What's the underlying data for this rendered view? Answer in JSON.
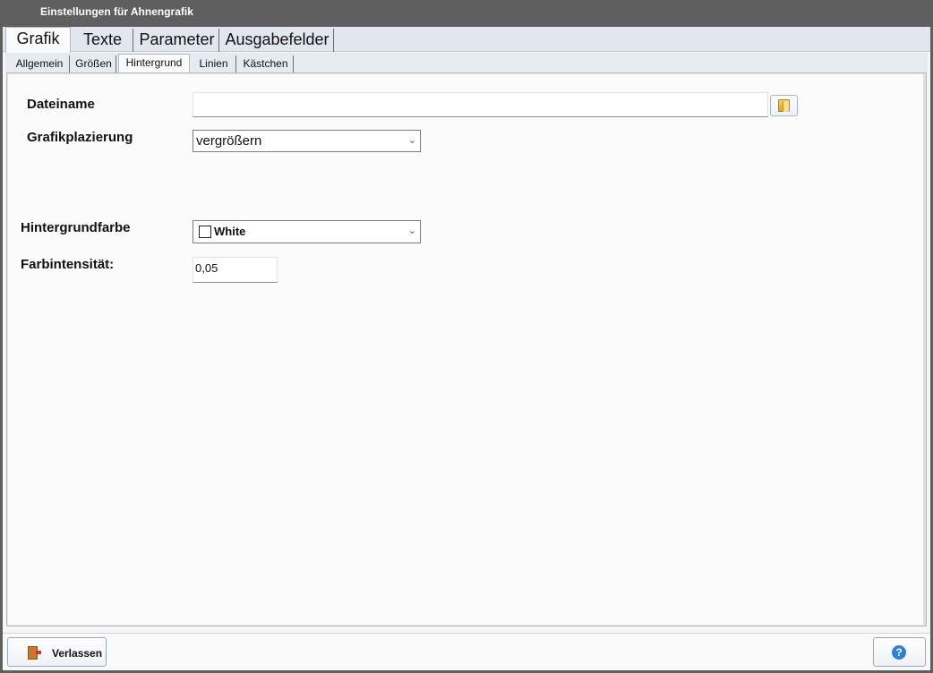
{
  "window": {
    "title": "Einstellungen für Ahnengrafik"
  },
  "main_tabs": [
    {
      "label": "Grafik",
      "active": true
    },
    {
      "label": "Texte",
      "active": false
    },
    {
      "label": "Parameter",
      "active": false
    },
    {
      "label": "Ausgabefelder",
      "active": false
    }
  ],
  "sub_tabs": [
    {
      "label": "Allgemein",
      "active": false
    },
    {
      "label": "Größen",
      "active": false
    },
    {
      "label": "Hintergrund",
      "active": true
    },
    {
      "label": "Linien",
      "active": false
    },
    {
      "label": "Kästchen",
      "active": false
    }
  ],
  "form": {
    "filename_label": "Dateiname",
    "filename_value": "",
    "placement_label": "Grafikplazierung",
    "placement_value": "vergrößern",
    "bgcolor_label": "Hintergrundfarbe",
    "bgcolor_value": "White",
    "bgcolor_swatch": "#ffffff",
    "intensity_label": "Farbintensität:",
    "intensity_value": "0,05"
  },
  "footer": {
    "leave_label": "Verlassen",
    "help_glyph": "?"
  },
  "icons": {
    "folder": "folder-open-icon",
    "leave": "exit-door-icon",
    "help": "help-icon"
  }
}
